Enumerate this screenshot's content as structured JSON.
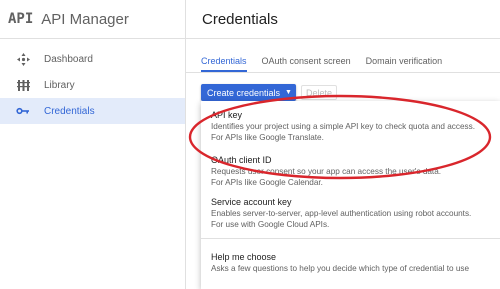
{
  "app": {
    "logo_text": "API",
    "title": "API Manager"
  },
  "sidebar": {
    "items": [
      {
        "label": "Dashboard",
        "icon": "dashboard-icon",
        "active": false
      },
      {
        "label": "Library",
        "icon": "library-icon",
        "active": false
      },
      {
        "label": "Credentials",
        "icon": "key-icon",
        "active": true
      }
    ]
  },
  "header": {
    "title": "Credentials"
  },
  "tabs": [
    {
      "label": "Credentials",
      "active": true
    },
    {
      "label": "OAuth consent screen",
      "active": false
    },
    {
      "label": "Domain verification",
      "active": false
    }
  ],
  "toolbar": {
    "create_label": "Create credentials",
    "delete_label": "Delete"
  },
  "menu": {
    "items": [
      {
        "title": "API key",
        "line1": "Identifies your project using a simple API key to check quota and access.",
        "line2": "For APIs like Google Translate."
      },
      {
        "title": "OAuth client ID",
        "line1": "Requests user consent so your app can access the user's data.",
        "line2": "For APIs like Google Calendar."
      },
      {
        "title": "Service account key",
        "line1": "Enables server-to-server, app-level authentication using robot accounts.",
        "line2": "For use with Google Cloud APIs."
      },
      {
        "title": "Help me choose",
        "line1": "Asks a few questions to help you decide which type of credential to use"
      }
    ]
  },
  "colors": {
    "accent": "#3367d6",
    "active_bg": "#e3ebfa",
    "highlight_ring": "#d9262c"
  }
}
